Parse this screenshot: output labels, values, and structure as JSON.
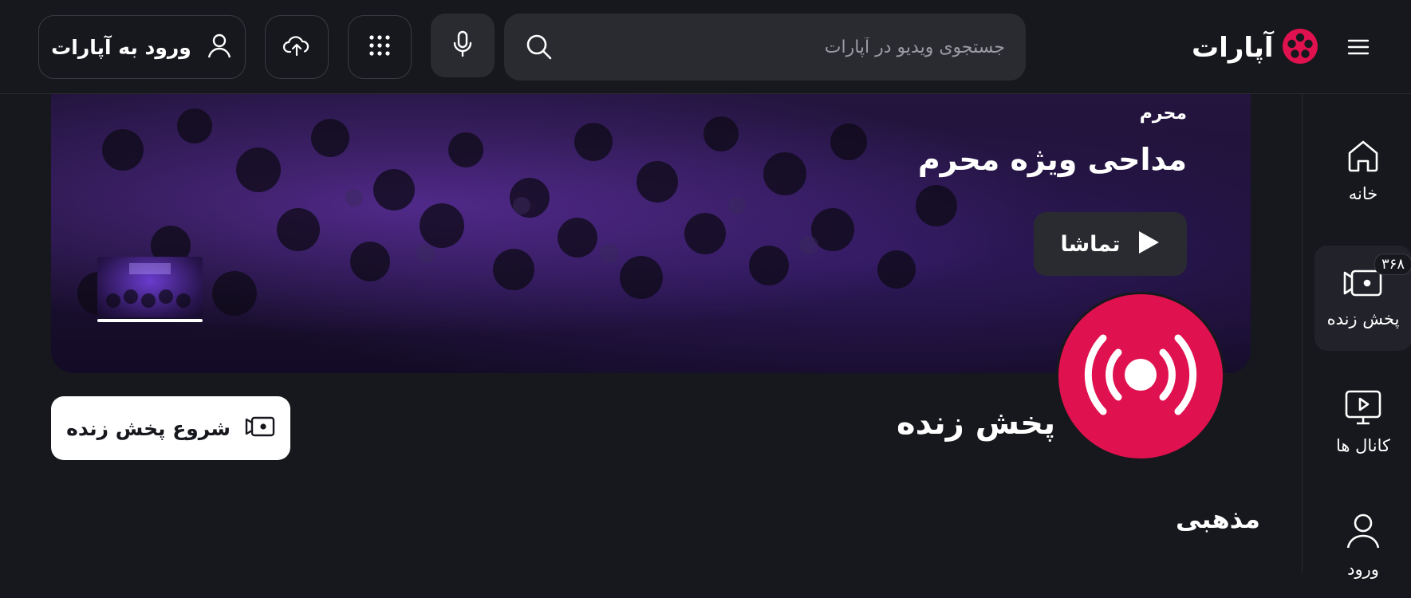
{
  "header": {
    "logo_text": "آپارات",
    "search_placeholder": "جستجوی ویدیو در آپارات",
    "login_label": "ورود به آپارات",
    "icons": {
      "menu": "hamburger-menu-icon",
      "logo": "aparat-reel-logo",
      "search": "search-icon",
      "mic": "microphone-icon",
      "apps": "grid-dots-icon",
      "upload": "cloud-upload-icon",
      "user": "user-icon"
    }
  },
  "sidebar": {
    "items": [
      {
        "label": "خانه",
        "icon": "home-icon"
      },
      {
        "label": "پخش زنده",
        "icon": "live-camera-icon",
        "badge": "۳۶۸",
        "active": true
      },
      {
        "label": "کانال ها",
        "icon": "tv-play-icon"
      },
      {
        "label": "ورود",
        "icon": "user-icon"
      }
    ]
  },
  "hero": {
    "category": "محرم",
    "title": "مداحی ویژه محرم",
    "watch_label": "تماشا",
    "progress": 1.0
  },
  "live": {
    "title": "پخش زنده",
    "start_label": "شروع پخش زنده",
    "icon": "broadcast-icon"
  },
  "sections": [
    {
      "title": "مذهبی"
    }
  ],
  "colors": {
    "background": "#17181d",
    "surface": "#2a2b31",
    "accent": "#e0114f"
  }
}
